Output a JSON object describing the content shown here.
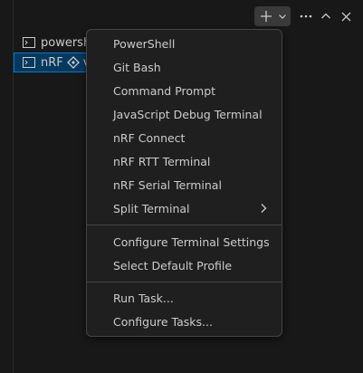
{
  "terminal_tabs": [
    {
      "label": "powersh",
      "icon": "terminal-icon"
    },
    {
      "label": "nRF",
      "icon": "terminal-icon",
      "extra": "v",
      "extra_icon": "nrf-connect-icon"
    }
  ],
  "toolbar": {
    "new_terminal_icon": "plus-icon",
    "profiles_icon": "chevron-down-icon",
    "more_icon": "ellipsis-icon",
    "maximize_icon": "chevron-up-icon",
    "close_icon": "close-icon"
  },
  "menu": {
    "group1": [
      {
        "label": "PowerShell"
      },
      {
        "label": "Git Bash"
      },
      {
        "label": "Command Prompt"
      },
      {
        "label": "JavaScript Debug Terminal"
      },
      {
        "label": "nRF Connect"
      },
      {
        "label": "nRF RTT Terminal"
      },
      {
        "label": "nRF Serial Terminal"
      },
      {
        "label": "Split Terminal",
        "submenu": true
      }
    ],
    "group2": [
      {
        "label": "Configure Terminal Settings"
      },
      {
        "label": "Select Default Profile"
      }
    ],
    "group3": [
      {
        "label": "Run Task..."
      },
      {
        "label": "Configure Tasks..."
      }
    ]
  }
}
